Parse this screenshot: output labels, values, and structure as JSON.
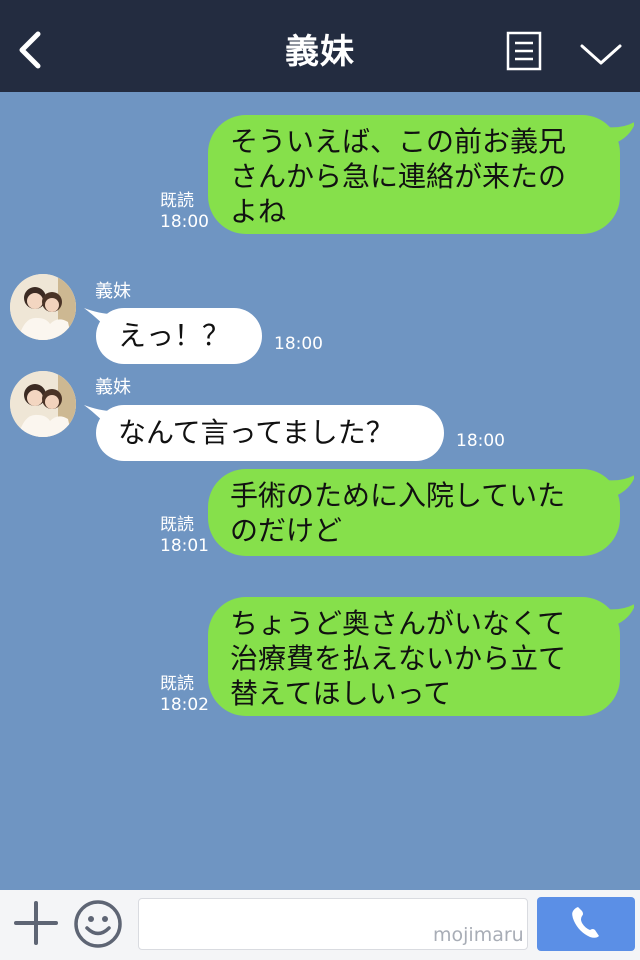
{
  "header": {
    "title": "義妹"
  },
  "colors": {
    "header_bg": "#232c40",
    "chat_bg": "#6f95c2",
    "outgoing_bubble": "#86e04b",
    "incoming_bubble": "#ffffff",
    "call_button": "#5b8fe6"
  },
  "messages": [
    {
      "direction": "out",
      "text": "そういえば、この前お義兄\nさんから急に連絡が来たの\nよね",
      "read": "既読",
      "time": "18:00"
    },
    {
      "direction": "in",
      "sender": "義妹",
      "text": "えっ！？",
      "time": "18:00"
    },
    {
      "direction": "in",
      "sender": "義妹",
      "text": "なんて言ってました？",
      "time": "18:00"
    },
    {
      "direction": "out",
      "text": "手術のために入院していた\nのだけど",
      "read": "既読",
      "time": "18:01"
    },
    {
      "direction": "out",
      "text": "ちょうど奥さんがいなくて\n治療費を払えないから立て\n替えてほしいって",
      "read": "既読",
      "time": "18:02"
    }
  ],
  "input": {
    "placeholder": "",
    "watermark": "mojimaru"
  },
  "icons": {
    "back": "chevron-left-icon",
    "menu": "list-icon",
    "more": "chevron-down-icon",
    "add": "plus-icon",
    "emoji": "smiley-icon",
    "call": "phone-icon"
  }
}
